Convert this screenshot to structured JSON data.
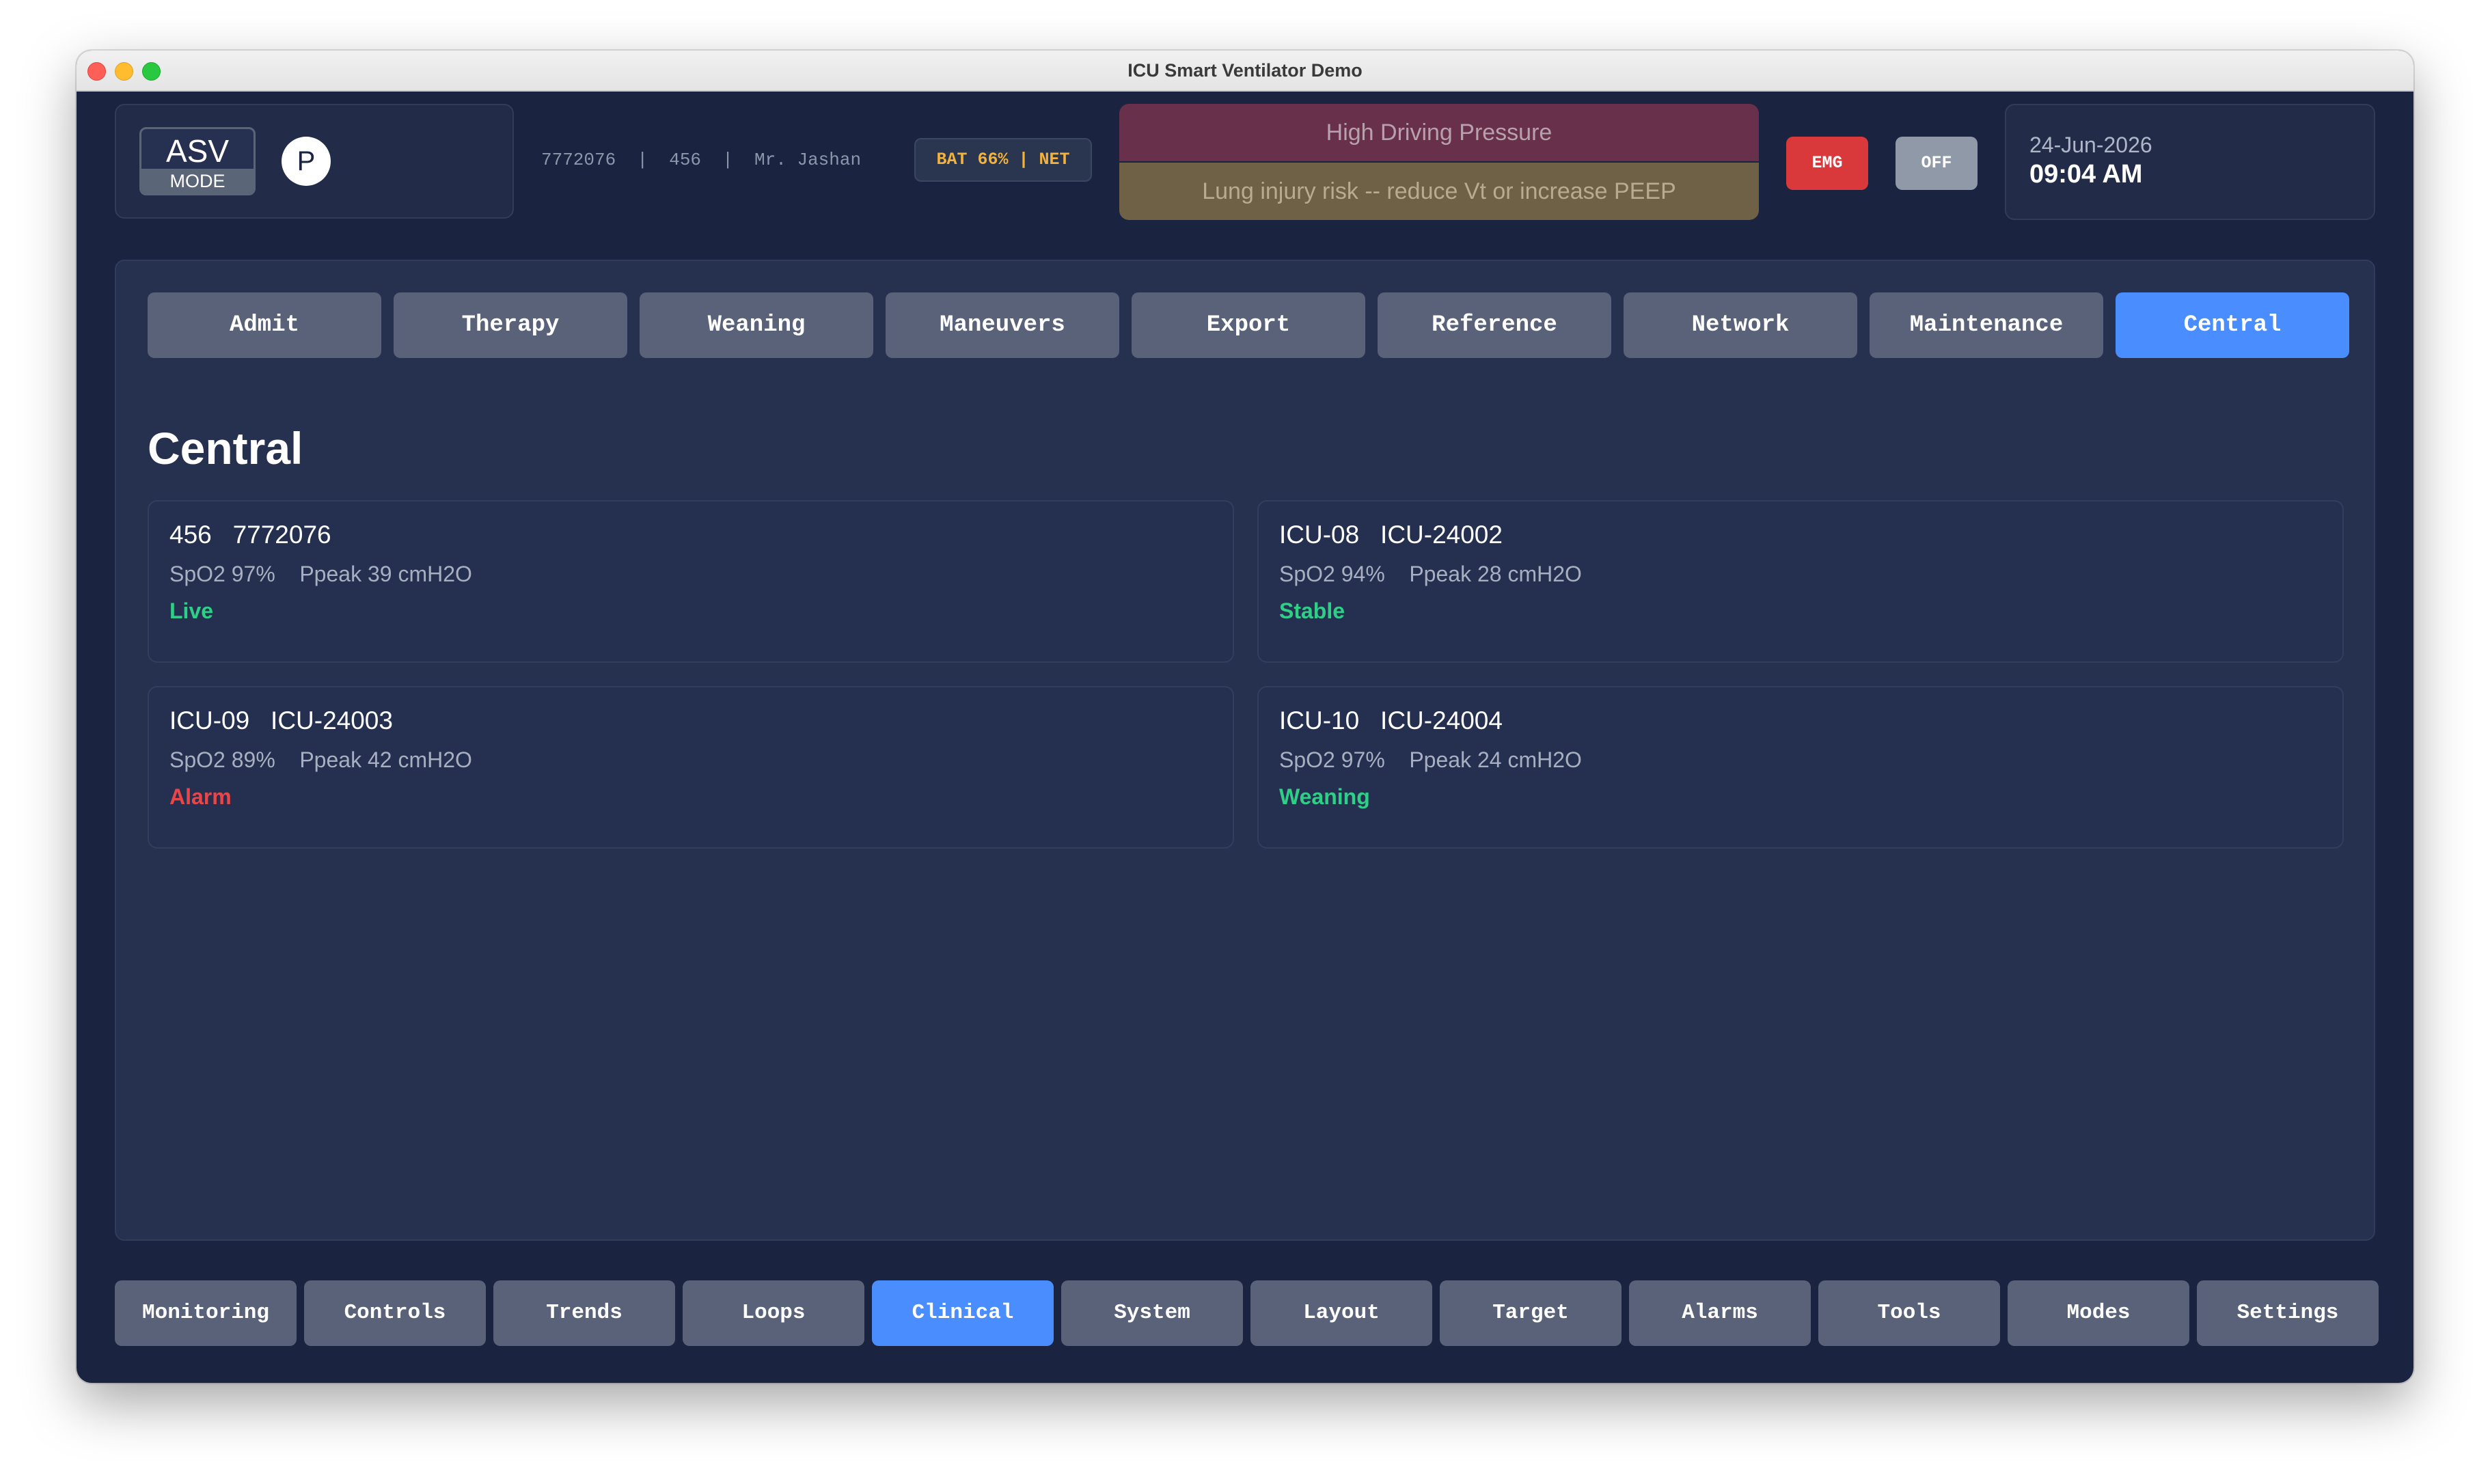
{
  "window": {
    "title": "ICU Smart Ventilator Demo"
  },
  "header": {
    "mode_name": "ASV",
    "mode_label": "MODE",
    "profile_letter": "P",
    "patient_info": "7772076  |  456  |  Mr. Jashan",
    "status_pill": "BAT 66% | NET",
    "alarm_title": "High Driving Pressure",
    "alarm_message": "Lung injury risk -- reduce Vt or increase PEEP",
    "emg_label": "EMG",
    "off_label": "OFF",
    "date": "24-Jun-2026",
    "time": "09:04 AM"
  },
  "tabs": [
    {
      "label": "Admit"
    },
    {
      "label": "Therapy"
    },
    {
      "label": "Weaning"
    },
    {
      "label": "Maneuvers"
    },
    {
      "label": "Export"
    },
    {
      "label": "Reference"
    },
    {
      "label": "Network"
    },
    {
      "label": "Maintenance"
    },
    {
      "label": "Central",
      "active": true
    }
  ],
  "section_title": "Central",
  "cards": [
    {
      "id": "456   7772076",
      "stats": "SpO2 97%    Ppeak 39 cmH2O",
      "status": "Live",
      "status_color": "#2fcf88"
    },
    {
      "id": "ICU-08   ICU-24002",
      "stats": "SpO2 94%    Ppeak 28 cmH2O",
      "status": "Stable",
      "status_color": "#2fcf88"
    },
    {
      "id": "ICU-09   ICU-24003",
      "stats": "SpO2 89%    Ppeak 42 cmH2O",
      "status": "Alarm",
      "status_color": "#e8474a"
    },
    {
      "id": "ICU-10   ICU-24004",
      "stats": "SpO2 97%    Ppeak 24 cmH2O",
      "status": "Weaning",
      "status_color": "#2fcf88"
    }
  ],
  "bottom_nav": [
    {
      "label": "Monitoring"
    },
    {
      "label": "Controls"
    },
    {
      "label": "Trends"
    },
    {
      "label": "Loops"
    },
    {
      "label": "Clinical",
      "active": true
    },
    {
      "label": "System"
    },
    {
      "label": "Layout"
    },
    {
      "label": "Target"
    },
    {
      "label": "Alarms"
    },
    {
      "label": "Tools"
    },
    {
      "label": "Modes"
    },
    {
      "label": "Settings"
    }
  ],
  "colors": {
    "accent": "#4a8dff",
    "background": "#1a2340",
    "panel": "#263150",
    "emergency": "#d9393b",
    "battery_text": "#f2b23c"
  }
}
